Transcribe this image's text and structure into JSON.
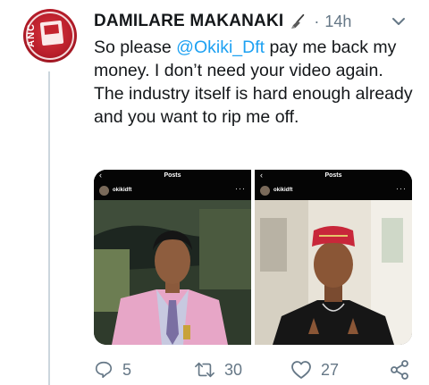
{
  "author": {
    "display_name": "DAMILARE MAKANAKI",
    "avatar_text": "ANC",
    "emoji_icon": "broom-emoji-icon"
  },
  "meta": {
    "separator": "·",
    "time": "14h"
  },
  "tweet": {
    "text_before": "So please ",
    "mention": "@Okiki_Dft",
    "text_after": " pay me back my money. I don’t need your video again. The industry itself is hard enough already and you want to rip me off."
  },
  "media": {
    "photos": [
      {
        "header_title": "Posts",
        "username": "okikidft"
      },
      {
        "header_title": "Posts",
        "username": "okikidft"
      }
    ]
  },
  "actions": {
    "reply_count": "5",
    "retweet_count": "30",
    "like_count": "27"
  },
  "colors": {
    "accent": "#1da1f2",
    "muted": "#657786",
    "divider": "#ccd6dd"
  }
}
